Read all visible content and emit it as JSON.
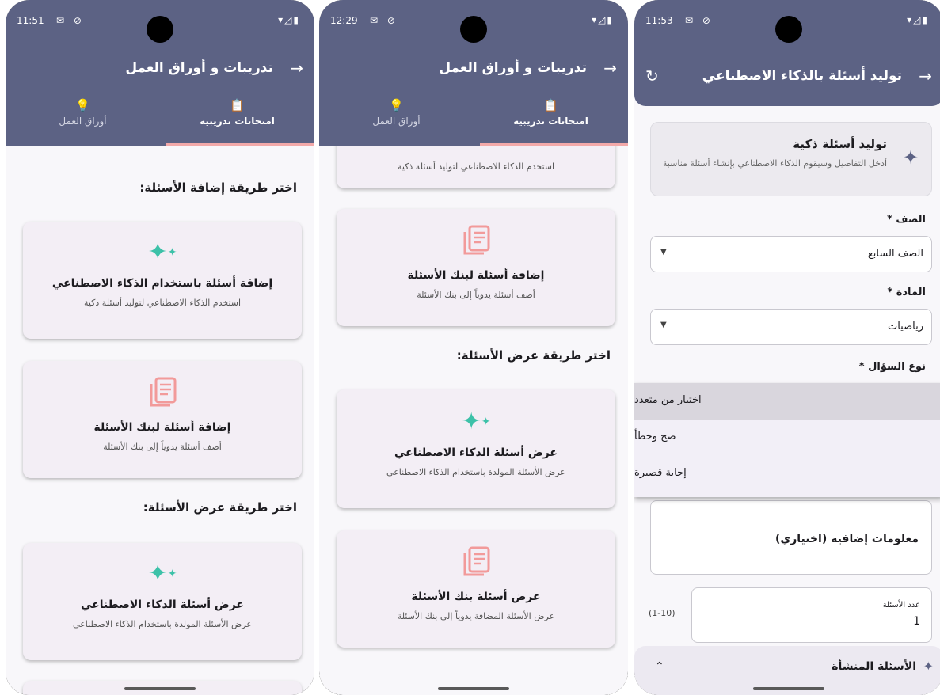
{
  "phone1": {
    "time": "11:51",
    "title": "تدريبات و أوراق العمل",
    "tab_training": "امتحانات تدريبية",
    "tab_worksheets": "أوراق العمل",
    "section_add": "اختر طريقة إضافة الأسئلة:",
    "card_ai_title": "إضافة أسئلة باستخدام الذكاء الاصطناعي",
    "card_ai_desc": "استخدم الذكاء الاصطناعي لتوليد أسئلة ذكية",
    "card_bank_title": "إضافة أسئلة لبنك الأسئلة",
    "card_bank_desc": "أضف أسئلة يدوياً إلى بنك الأسئلة",
    "section_view": "اختر طريقة عرض الأسئلة:",
    "card_view_ai_title": "عرض أسئلة الذكاء الاصطناعي",
    "card_view_ai_desc": "عرض الأسئلة المولدة باستخدام الذكاء الاصطناعي"
  },
  "phone2": {
    "time": "12:29",
    "title": "تدريبات و أوراق العمل",
    "tab_training": "امتحانات تدريبية",
    "tab_worksheets": "أوراق العمل",
    "card_partial_desc": "استخدم الذكاء الاصطناعي لتوليد أسئلة ذكية",
    "card_bank_title": "إضافة أسئلة لبنك الأسئلة",
    "card_bank_desc": "أضف أسئلة يدوياً إلى بنك الأسئلة",
    "section_view": "اختر طريقة عرض الأسئلة:",
    "card_view_ai_title": "عرض أسئلة الذكاء الاصطناعي",
    "card_view_ai_desc": "عرض الأسئلة المولدة باستخدام الذكاء الاصطناعي",
    "card_view_bank_title": "عرض أسئلة بنك الأسئلة",
    "card_view_bank_desc": "عرض الأسئلة المضافة يدوياً إلى بنك الأسئلة"
  },
  "phone3": {
    "time": "11:53",
    "title": "توليد أسئلة بالذكاء الاصطناعي",
    "info_title": "توليد أسئلة ذكية",
    "info_desc": "أدخل التفاصيل وسيقوم الذكاء الاصطناعي بإنشاء أسئلة مناسبة",
    "label_grade": "الصف *",
    "grade_value": "الصف السابع",
    "label_subject": "المادة *",
    "subject_value": "رياضيات",
    "label_qtype": "نوع السؤال *",
    "menu_options": [
      "اختيار من متعدد",
      "صح وخطأ",
      "إجابة قصيرة"
    ],
    "extra_label": "معلومات إضافية (اختياري)",
    "count_label": "عدد الأسئلة",
    "count_value": "1",
    "count_range": "(1-10)",
    "generated_label": "الأسئلة المنشأة"
  },
  "colors": {
    "appbar": "#5c6284",
    "accent": "#3cc1a8",
    "book": "#f29a9a",
    "indicator": "#f3a9a9"
  },
  "icons": [
    "back-arrow-icon",
    "refresh-icon",
    "lightbulb-icon",
    "clipboard-icon",
    "sparkle-icon",
    "book-stack-icon",
    "dropdown-arrow-icon",
    "chevron-up-icon"
  ]
}
